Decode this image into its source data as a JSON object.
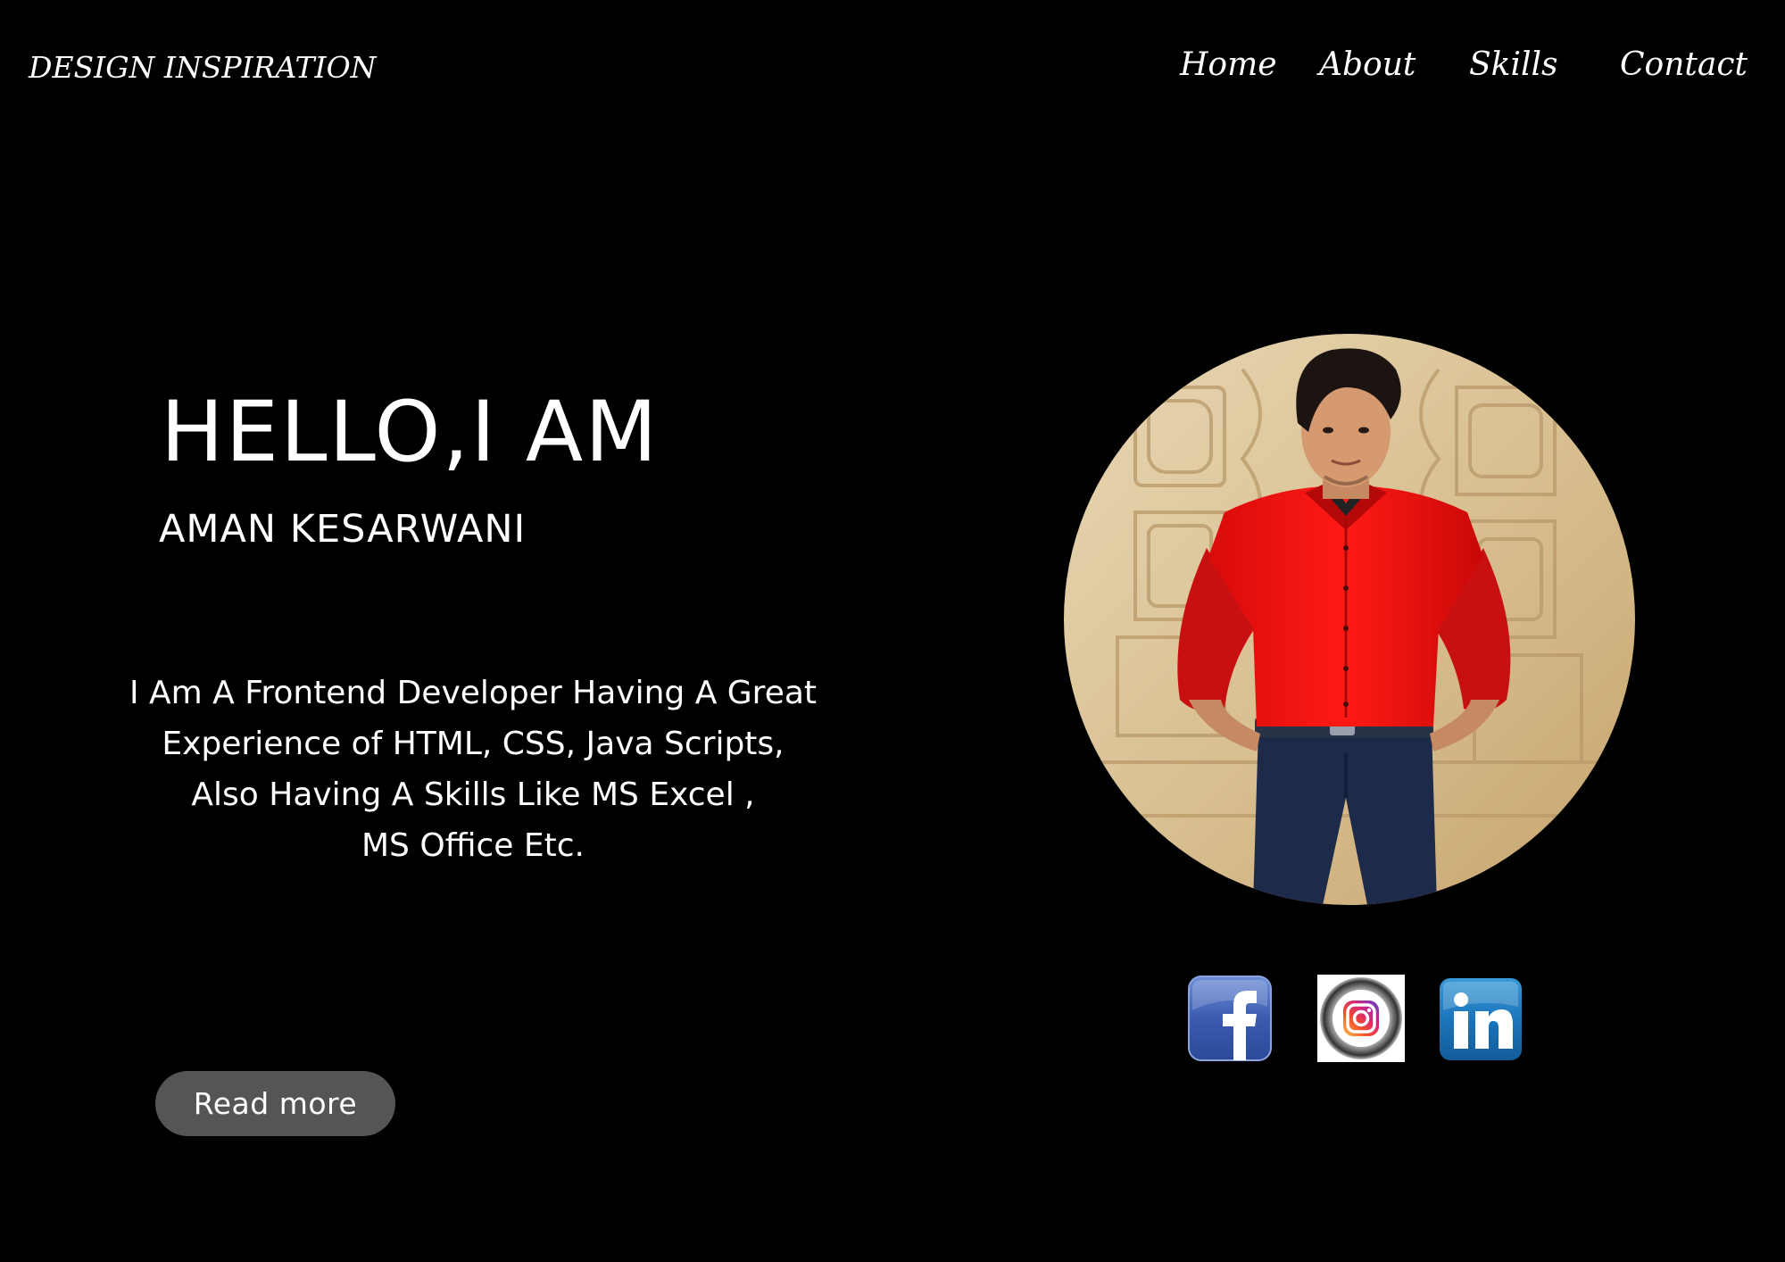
{
  "brand": {
    "logo_text": "DESIGN INSPIRATION"
  },
  "nav": {
    "items": [
      {
        "label": "Home"
      },
      {
        "label": "About"
      },
      {
        "label": "Skills"
      },
      {
        "label": "Contact"
      }
    ]
  },
  "hero": {
    "greeting": "HELLO,I AM",
    "name": "AMAN KESARWANI",
    "description_lines": [
      "I Am A Frontend Developer Having A Great",
      "Experience of HTML, CSS, Java Scripts,",
      "Also Having A Skills Like MS Excel ,",
      "MS Office Etc."
    ],
    "cta_label": "Read more"
  },
  "social": {
    "links": [
      {
        "icon": "facebook-icon",
        "letter": "f",
        "color": "#3b5998"
      },
      {
        "icon": "instagram-icon",
        "color": "#e1306c"
      },
      {
        "icon": "linkedin-icon",
        "letter": "in",
        "color": "#1b75bb"
      }
    ]
  },
  "colors": {
    "background": "#000000",
    "text": "#ffffff",
    "button": "#555555"
  }
}
